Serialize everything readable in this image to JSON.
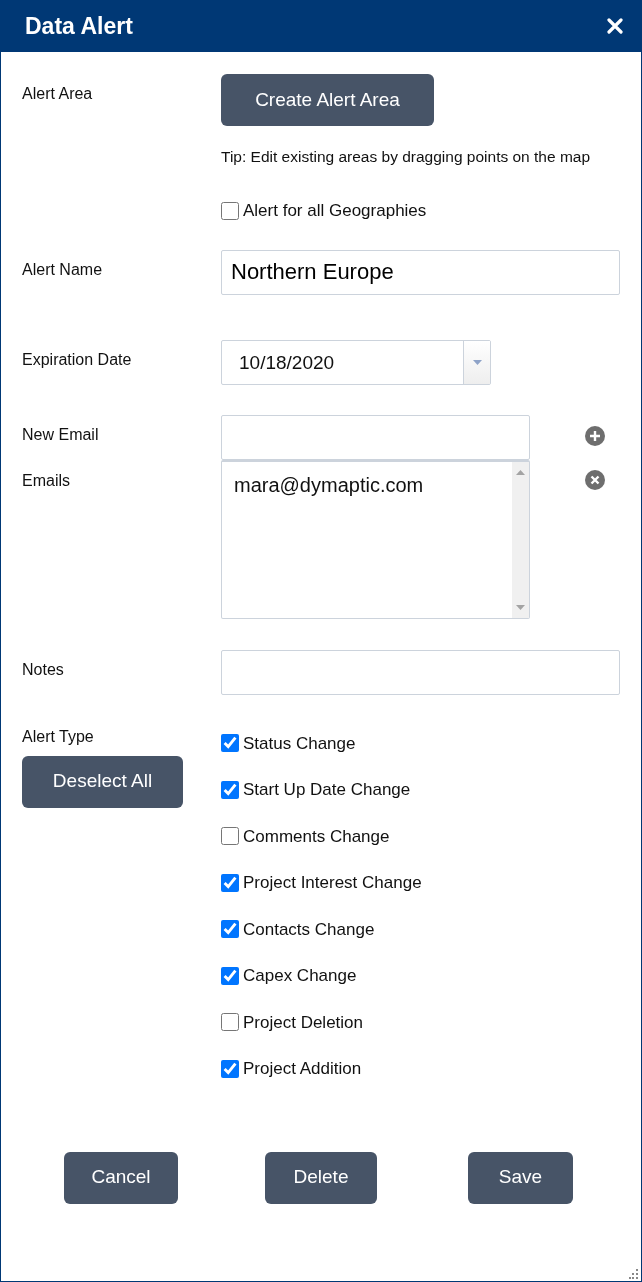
{
  "window": {
    "title": "Data Alert"
  },
  "alert_area": {
    "label": "Alert Area",
    "button": "Create Alert Area",
    "tip": "Tip: Edit existing areas by dragging points on the map",
    "all_geographies": {
      "label": "Alert for all Geographies",
      "checked": false
    }
  },
  "alert_name": {
    "label": "Alert Name",
    "value": "Northern Europe"
  },
  "expiration_date": {
    "label": "Expiration Date",
    "value": "10/18/2020"
  },
  "new_email": {
    "label": "New Email"
  },
  "emails": {
    "label": "Emails",
    "items": [
      "mara@dymaptic.com"
    ]
  },
  "notes": {
    "label": "Notes"
  },
  "alert_type": {
    "label": "Alert Type",
    "button": "Deselect All",
    "options": [
      {
        "label": "Status Change",
        "checked": true
      },
      {
        "label": "Start Up Date Change",
        "checked": true
      },
      {
        "label": "Comments Change",
        "checked": false
      },
      {
        "label": "Project Interest Change",
        "checked": true
      },
      {
        "label": "Contacts Change",
        "checked": true
      },
      {
        "label": "Capex Change",
        "checked": true
      },
      {
        "label": "Project Deletion",
        "checked": false
      },
      {
        "label": "Project Addition",
        "checked": true
      }
    ]
  },
  "buttons": [
    "Cancel",
    "Delete",
    "Save"
  ]
}
